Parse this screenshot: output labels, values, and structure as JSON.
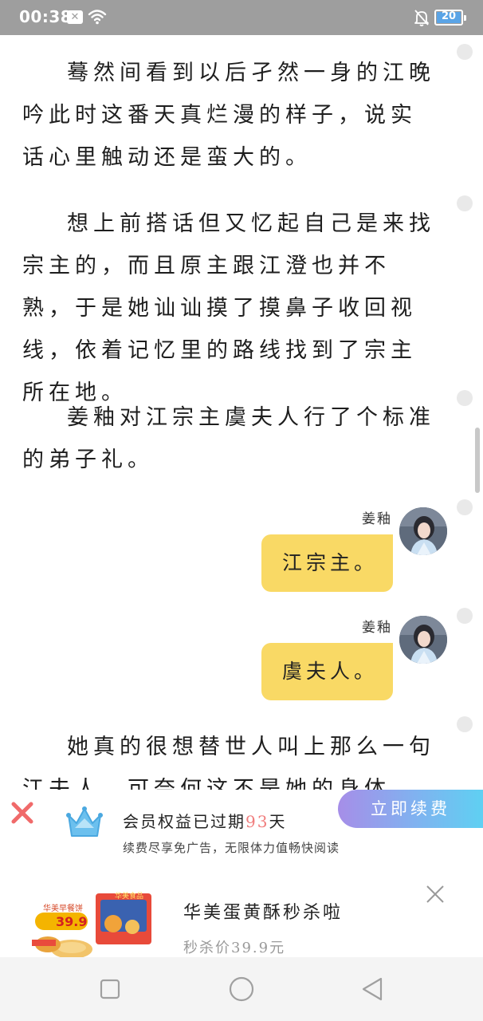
{
  "status_bar": {
    "time": "00:38",
    "notification_badge": "✕",
    "battery_level": "20",
    "icons": [
      "wifi-icon",
      "mute-icon",
      "battery-icon"
    ]
  },
  "reader": {
    "paragraphs": [
      "蓦然间看到以后孑然一身的江晚吟此时这番天真烂漫的样子，说实话心里触动还是蛮大的。",
      "想上前搭话但又忆起自己是来找宗主的，而且原主跟江澄也并不熟，于是她讪讪摸了摸鼻子收回视线，依着记忆里的路线找到了宗主所在地。",
      "姜釉对江宗主虞夫人行了个标准的弟子礼。",
      "她真的很想替世人叫上那么一句江夫人，可奈何这不是她的身体，好歹原主也"
    ],
    "chat": [
      {
        "name": "姜釉",
        "text": "江宗主。"
      },
      {
        "name": "姜釉",
        "text": "虞夫人。"
      }
    ]
  },
  "member": {
    "title_prefix": "会员权益已过期",
    "days": "93",
    "title_suffix": "天",
    "subtitle": "续费尽享免广告，无限体力值畅快阅读",
    "renew_label": "立即续费"
  },
  "ad": {
    "title": "华美蛋黄酥秒杀啦",
    "price": "秒杀价39.9元",
    "image_badge": "华美早餐饼",
    "image_price": "39.9",
    "image_brand": "华美食品"
  },
  "colors": {
    "bubble": "#f9d965",
    "accent_number": "#f07c7c",
    "renew_gradient_start": "#a68ee8",
    "renew_gradient_end": "#5fd0f2",
    "status_bar": "#9e9e9e"
  }
}
